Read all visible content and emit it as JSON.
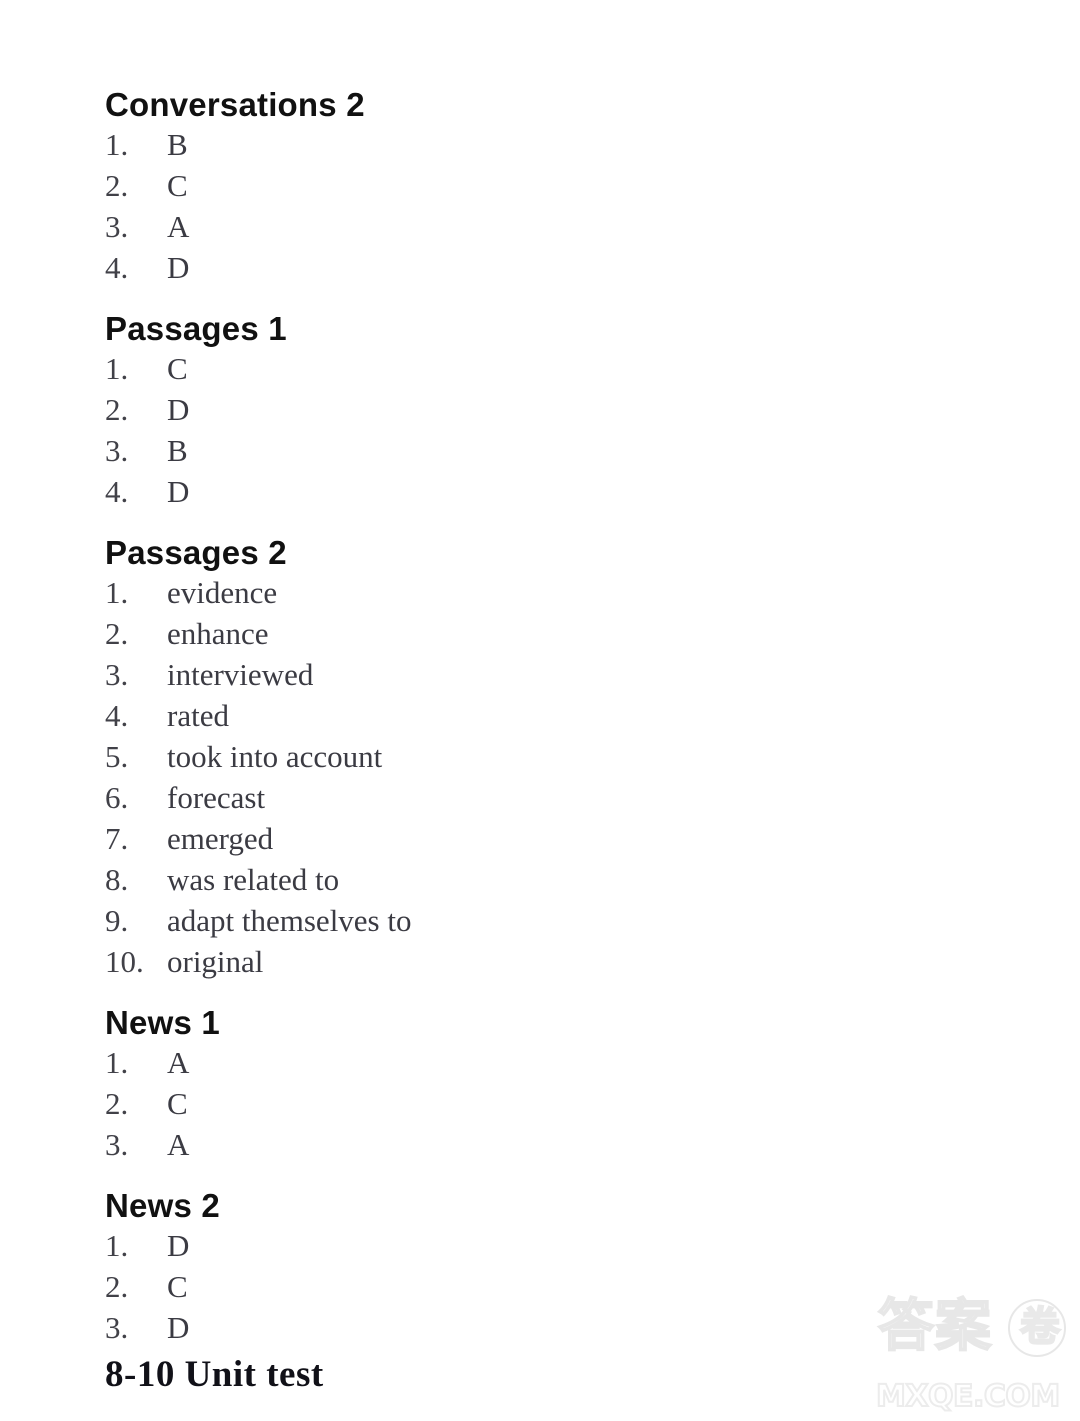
{
  "page": {
    "background_color": "#ffffff",
    "text_color": "#2b2b33",
    "heading_color": "#111111"
  },
  "sections": [
    {
      "heading": "Conversations 2",
      "items": [
        {
          "number": "1.",
          "answer": "B"
        },
        {
          "number": "2.",
          "answer": "C"
        },
        {
          "number": "3.",
          "answer": "A"
        },
        {
          "number": "4.",
          "answer": "D"
        }
      ]
    },
    {
      "heading": "Passages 1",
      "items": [
        {
          "number": "1.",
          "answer": "C"
        },
        {
          "number": "2.",
          "answer": "D"
        },
        {
          "number": "3.",
          "answer": "B"
        },
        {
          "number": "4.",
          "answer": "D"
        }
      ]
    },
    {
      "heading": "Passages 2",
      "items": [
        {
          "number": "1.",
          "answer": "evidence"
        },
        {
          "number": "2.",
          "answer": "enhance"
        },
        {
          "number": "3.",
          "answer": "interviewed"
        },
        {
          "number": "4.",
          "answer": "rated"
        },
        {
          "number": "5.",
          "answer": "took into account"
        },
        {
          "number": "6.",
          "answer": "forecast"
        },
        {
          "number": "7.",
          "answer": "emerged"
        },
        {
          "number": "8.",
          "answer": "was related to"
        },
        {
          "number": "9.",
          "answer": "adapt themselves to"
        },
        {
          "number": "10.",
          "answer": "original"
        }
      ]
    },
    {
      "heading": "News 1",
      "items": [
        {
          "number": "1.",
          "answer": "A"
        },
        {
          "number": "2.",
          "answer": "C"
        },
        {
          "number": "3.",
          "answer": "A"
        }
      ]
    },
    {
      "heading": "News 2",
      "items": [
        {
          "number": "1.",
          "answer": "D"
        },
        {
          "number": "2.",
          "answer": "C"
        },
        {
          "number": "3.",
          "answer": "D"
        }
      ]
    }
  ],
  "unit_test_title": "8-10 Unit test",
  "watermark": {
    "cjk_text": "答案",
    "circle_char": "卷",
    "domain": "MXQE.COM",
    "color": "#e8e8e8"
  }
}
